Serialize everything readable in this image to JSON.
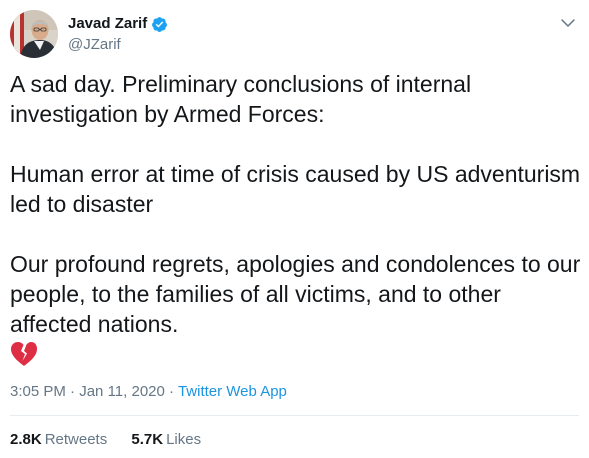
{
  "author": {
    "display_name": "Javad Zarif",
    "handle": "@JZarif",
    "verified": true,
    "avatar_icon": "profile-photo"
  },
  "tweet": {
    "paragraphs": [
      "A sad day. Preliminary conclusions of internal investigation by Armed Forces:",
      "Human error at time of crisis caused by US adventurism led to disaster",
      "Our profound regrets, apologies and condolences to our people, to the families of all victims, and to other affected nations."
    ],
    "emoji": "broken-heart-icon",
    "time": "3:05 PM",
    "separator": "·",
    "date": "Jan 11, 2020",
    "source": "Twitter Web App"
  },
  "stats": {
    "retweets_count": "2.8K",
    "retweets_label": "Retweets",
    "likes_count": "5.7K",
    "likes_label": "Likes"
  },
  "colors": {
    "link": "#1b95e0",
    "secondary_text": "#657786",
    "verified_badge": "#1da1f2",
    "broken_heart": "#dd2e44"
  }
}
